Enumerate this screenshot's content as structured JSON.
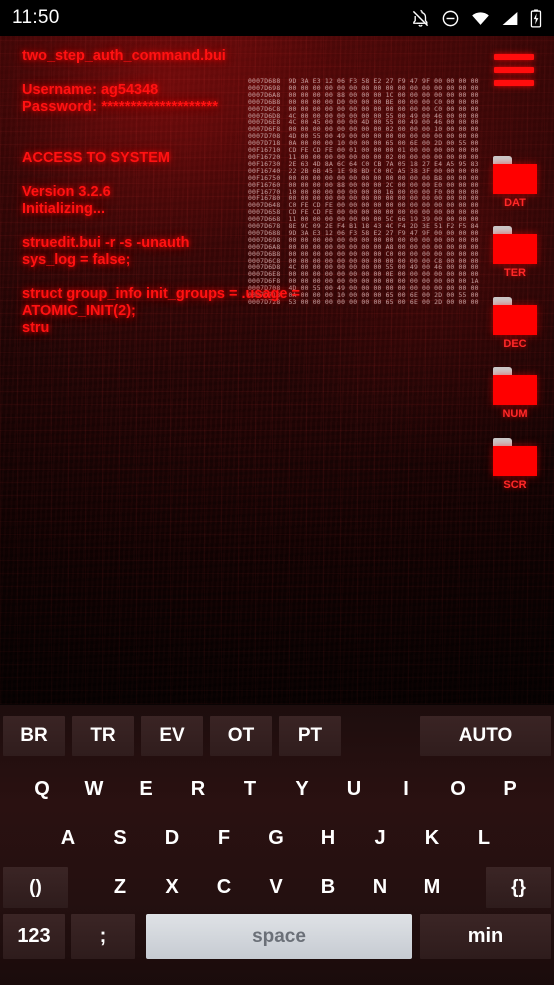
{
  "status_bar": {
    "time": "11:50",
    "icons": [
      "notifications-off-icon",
      "do-not-disturb-icon",
      "wifi-icon",
      "cellular-signal-icon",
      "battery-charging-icon"
    ]
  },
  "terminal": {
    "file_title": "two_step_auth_command.bui",
    "username_line": "Username: ag54348",
    "password_label": "Password:",
    "password_mask": "********************",
    "access_line": "ACCESS TO SYSTEM",
    "version_line": "Version 3.2.6",
    "init_line": "Initializing...",
    "cmd_line": "struedit.bui -r -s -unauth",
    "syslog_line": "sys_log = false;",
    "struct_line": "struct group_info init_groups = .usage = ATOMIC_INIT(2);",
    "struct_tail": "stru",
    "text_color": "#ff1212"
  },
  "hexdump": {
    "lines": [
      "0007D688  9D 3A E3 12 06 F3 58 E2 27 F9 47 9F 00 00 00 00",
      "0007D698  00 00 00 00 00 00 00 00 00 00 00 00 00 00 00 00",
      "0007D6A8  00 00 00 00 88 00 00 00 1C 00 00 00 00 00 00 00",
      "0007D6B8  00 00 00 00 D0 00 00 00 BE 00 00 00 C0 00 00 00",
      "0007D6C8  00 00 00 00 00 00 00 00 00 00 00 00 C0 00 00 00",
      "0007D6D8  4C 00 00 00 00 00 00 00 55 00 49 00 46 00 00 00",
      "0007D6E8  4C 00 45 00 00 00 4D 00 55 00 49 00 46 00 00 00",
      "0007D6F8  00 00 00 00 00 00 00 00 02 00 00 00 10 00 00 00",
      "0007D708  4D 00 55 00 49 00 00 00 00 00 00 00 00 00 00 00",
      "0007D718  0A 00 00 00 10 00 00 00 65 00 6E 00 2D 00 55 00",
      "00F16710  CD FE CD FE 00 01 00 00 00 01 00 00 00 00 00 00",
      "00F16720  11 00 00 00 00 00 00 00 02 00 00 00 00 00 00 00",
      "00F16730  2E 63 4D 8A 6C 64 C0 CB 7A 05 18 27 E4 A5 95 83",
      "00F16740  22 2B 6B 45 1E 98 BD C0 0C A5 38 3F 00 00 00 00",
      "00F16750  00 00 00 00 00 00 00 00 00 00 00 00 B8 00 00 00",
      "00F16760  00 00 00 00 88 00 00 00 2C 00 00 00 E0 00 00 00",
      "00F16770  10 00 00 00 00 00 00 00 16 00 00 00 F0 00 00 00",
      "00F16780  00 00 00 00 00 00 00 00 00 00 00 00 00 00 00 00",
      "0007D648  C0 FE CD FE 00 00 00 00 00 00 00 00 00 00 00 00",
      "0007D658  CD FE CD FE 00 00 00 00 00 00 00 00 00 00 00 00",
      "0007D668  11 00 00 00 00 00 00 00 5C 66 19 39 00 00 00 00",
      "0007D678  8E 9C 09 2E F4 B1 18 43 4C F4 2D 3E 51 F2 F5 84",
      "0007D688  9D 3A E3 12 06 F3 58 E2 27 F9 47 9F 00 00 00 00",
      "0007D698  00 00 00 00 00 00 00 00 00 00 00 00 00 00 00 00",
      "0007D6A8  00 00 00 00 00 00 00 00 A8 00 00 00 00 00 00 00",
      "0007D6B8  00 00 00 00 00 00 00 00 C0 00 00 00 00 00 00 00",
      "0007D6C8  00 00 00 00 00 00 00 00 00 00 00 00 C8 00 00 00",
      "0007D6D8  4C 00 00 00 00 00 00 00 55 00 49 00 46 00 00 00",
      "0007D6E8  00 00 00 00 00 00 00 00 0E 00 00 00 00 00 00 00",
      "0007D6F8  00 00 00 00 00 00 00 00 00 00 00 00 00 00 00 1A",
      "0007D708  4D 00 55 00 49 00 00 00 00 00 00 00 00 00 00 00",
      "0007D718  0A 00 00 00 10 00 00 00 65 00 6E 00 2D 00 55 00",
      "0007D728  53 00 00 00 00 00 00 00 65 00 6E 00 2D 00 00 00"
    ]
  },
  "rail": {
    "menu_icon": "hamburger-menu-icon",
    "folders": [
      {
        "label": "DAT",
        "icon": "folder-icon"
      },
      {
        "label": "TER",
        "icon": "folder-icon"
      },
      {
        "label": "DEC",
        "icon": "folder-icon"
      },
      {
        "label": "NUM",
        "icon": "folder-icon"
      },
      {
        "label": "SCR",
        "icon": "folder-icon"
      }
    ]
  },
  "keyboard": {
    "function_keys": [
      "BR",
      "TR",
      "EV",
      "OT",
      "PT"
    ],
    "auto_key": "AUTO",
    "row1": [
      "Q",
      "W",
      "E",
      "R",
      "T",
      "Y",
      "U",
      "I",
      "O",
      "P"
    ],
    "row2": [
      "A",
      "S",
      "D",
      "F",
      "G",
      "H",
      "J",
      "K",
      "L"
    ],
    "row3_left": "()",
    "row3": [
      "Z",
      "X",
      "C",
      "V",
      "B",
      "N",
      "M"
    ],
    "row3_right": "{}",
    "numeric_key": "123",
    "semicolon_key": ";",
    "space_key": "space",
    "min_key": "min"
  }
}
